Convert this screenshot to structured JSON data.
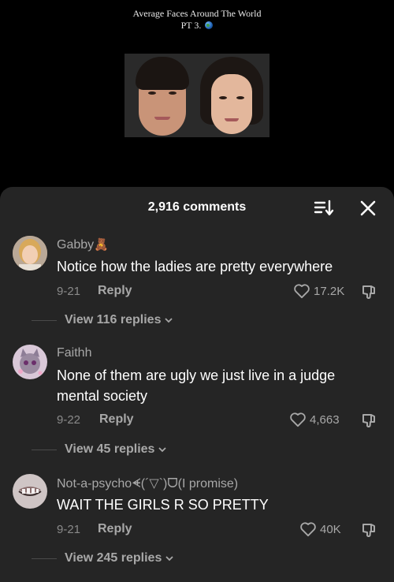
{
  "video": {
    "title_line1": "Average Faces Around The World",
    "title_line2": "PT 3."
  },
  "comments_sheet": {
    "count_label": "2,916 comments",
    "comments": [
      {
        "username": "Gabby",
        "text": "Notice how the ladies are pretty everywhere",
        "date": "9-21",
        "reply_label": "Reply",
        "likes": "17.2K",
        "view_replies": "View 116 replies"
      },
      {
        "username": "Faithh",
        "text": "None of them are ugly we just live in a judge mental society",
        "date": "9-22",
        "reply_label": "Reply",
        "likes": "4,663",
        "view_replies": "View 45 replies"
      },
      {
        "username": "Not-a-psychoᗛ(´▽`)ᗜ(I promise)",
        "text": "WAIT THE GIRLS R SO PRETTY",
        "date": "9-21",
        "reply_label": "Reply",
        "likes": "40K",
        "view_replies": "View 245 replies"
      }
    ]
  },
  "icons": {
    "sort": "sort-icon",
    "close": "close-icon",
    "heart": "heart-icon",
    "dislike": "dislike-icon",
    "chevron": "chevron-down-icon",
    "globe": "globe-icon",
    "teddy": "teddy-bear-emoji"
  },
  "colors": {
    "background": "#000000",
    "sheet": "#252525",
    "text_primary": "#ffffff",
    "text_secondary": "#a8a8a8"
  }
}
